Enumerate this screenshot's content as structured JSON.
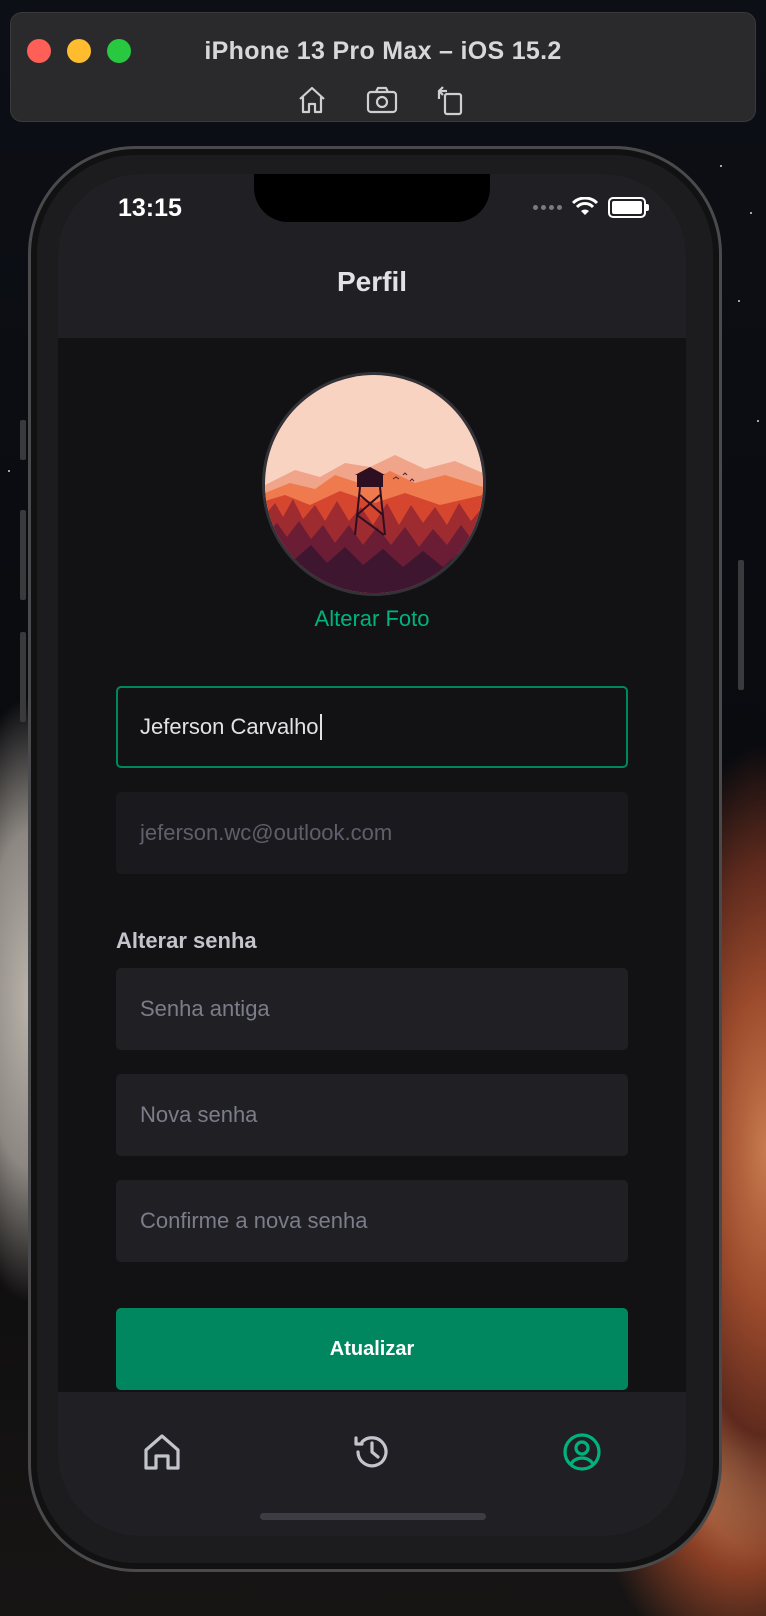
{
  "simulator": {
    "title": "iPhone 13 Pro Max – iOS 15.2",
    "tools": [
      "home-icon",
      "screenshot-icon",
      "rotate-icon"
    ]
  },
  "status_bar": {
    "time": "13:15",
    "icons": [
      "signal-dots-icon",
      "wifi-icon",
      "battery-icon"
    ]
  },
  "header": {
    "title": "Perfil"
  },
  "avatar": {
    "change_label": "Alterar Foto"
  },
  "form": {
    "name_value": "Jeferson Carvalho",
    "email_value": "jeferson.wc@outlook.com",
    "password_section_label": "Alterar senha",
    "old_password_placeholder": "Senha antiga",
    "new_password_placeholder": "Nova senha",
    "confirm_password_placeholder": "Confirme a nova senha",
    "submit_label": "Atualizar"
  },
  "tab_bar": {
    "items": [
      {
        "icon": "home-icon",
        "active": false
      },
      {
        "icon": "history-icon",
        "active": false
      },
      {
        "icon": "user-circle-icon",
        "active": true
      }
    ]
  },
  "colors": {
    "accent": "#00b37e",
    "button": "#00875f",
    "background": "#121214",
    "surface": "#202024"
  }
}
